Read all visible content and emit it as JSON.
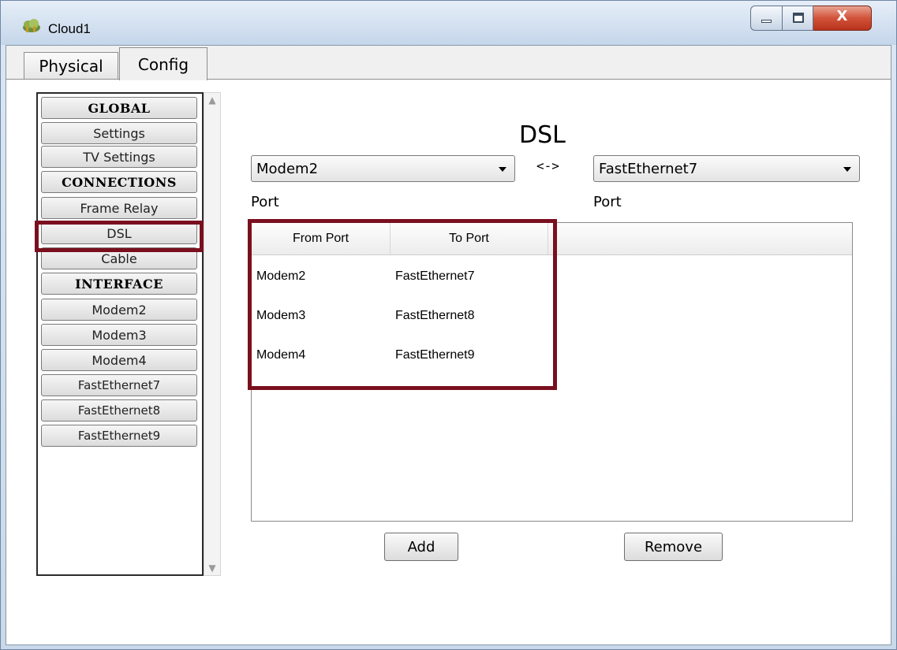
{
  "window": {
    "title": "Cloud1",
    "close_glyph": "X"
  },
  "tabs": [
    {
      "label": "Physical",
      "selected": false
    },
    {
      "label": "Config",
      "selected": true
    }
  ],
  "sidebar": {
    "items": [
      {
        "label": "GLOBAL",
        "type": "header"
      },
      {
        "label": "Settings",
        "type": "item"
      },
      {
        "label": "TV Settings",
        "type": "item"
      },
      {
        "label": "CONNECTIONS",
        "type": "header"
      },
      {
        "label": "Frame Relay",
        "type": "item"
      },
      {
        "label": "DSL",
        "type": "item",
        "selected": true
      },
      {
        "label": "Cable",
        "type": "item"
      },
      {
        "label": "INTERFACE",
        "type": "header"
      },
      {
        "label": "Modem2",
        "type": "item"
      },
      {
        "label": "Modem3",
        "type": "item"
      },
      {
        "label": "Modem4",
        "type": "item"
      },
      {
        "label": "FastEthernet7",
        "type": "item"
      },
      {
        "label": "FastEthernet8",
        "type": "item"
      },
      {
        "label": "FastEthernet9",
        "type": "item"
      }
    ]
  },
  "main": {
    "title": "DSL",
    "from_select": "Modem2",
    "to_select": "FastEthernet7",
    "link_symbol": "<->",
    "from_port_label": "Port",
    "to_port_label": "Port",
    "table": {
      "columns": [
        "From Port",
        "To Port"
      ],
      "rows": [
        [
          "Modem2",
          "FastEthernet7"
        ],
        [
          "Modem3",
          "FastEthernet8"
        ],
        [
          "Modem4",
          "FastEthernet9"
        ]
      ]
    },
    "add_label": "Add",
    "remove_label": "Remove"
  },
  "colors": {
    "highlight": "#7a0f1e"
  }
}
